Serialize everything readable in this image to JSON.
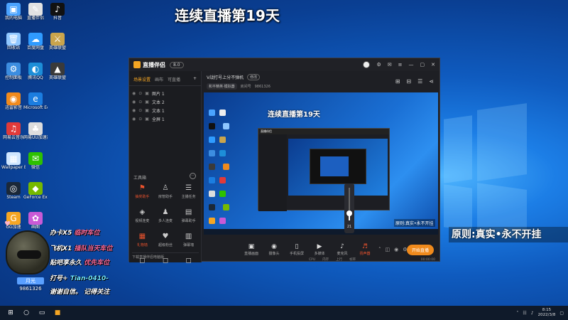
{
  "stream_title": "连续直播第19天",
  "desktop": {
    "icons": [
      {
        "label": "我的电脑",
        "color": "#4aa3ff",
        "glyph": "▣",
        "col": 0,
        "row": 0
      },
      {
        "label": "回收站",
        "color": "#8fc7ff",
        "glyph": "🗑",
        "col": 0,
        "row": 1
      },
      {
        "label": "控制面板",
        "color": "#3c8de0",
        "glyph": "⚙",
        "col": 0,
        "row": 2
      },
      {
        "label": "迅雷影音",
        "color": "#f08a1c",
        "glyph": "◉",
        "col": 0,
        "row": 3
      },
      {
        "label": "网易云音乐",
        "color": "#e03a3a",
        "glyph": "♫",
        "col": 0,
        "row": 4
      },
      {
        "label": "Wallpaper Engine",
        "color": "#cfe6ff",
        "glyph": "▦",
        "col": 0,
        "row": 5
      },
      {
        "label": "Steam",
        "color": "#1b2838",
        "glyph": "◎",
        "col": 0,
        "row": 6
      },
      {
        "label": "GG加速",
        "color": "#f5a623",
        "glyph": "G",
        "col": 0,
        "row": 7
      },
      {
        "label": "直播伴侣",
        "color": "#e2e2e2",
        "glyph": "✎",
        "col": 1,
        "row": 0
      },
      {
        "label": "百度网盘",
        "color": "#2f9bff",
        "glyph": "☁",
        "col": 1,
        "row": 1
      },
      {
        "label": "腾讯QQ",
        "color": "#1d8ed8",
        "glyph": "◐",
        "col": 1,
        "row": 2
      },
      {
        "label": "Microsoft Edge",
        "color": "#1b7de0",
        "glyph": "e",
        "col": 1,
        "row": 3
      },
      {
        "label": "网易UU加速器",
        "color": "#dddddd",
        "glyph": "♣",
        "col": 1,
        "row": 4
      },
      {
        "label": "微信",
        "color": "#2dc100",
        "glyph": "✉",
        "col": 1,
        "row": 5
      },
      {
        "label": "GeForce Experience",
        "color": "#76b900",
        "glyph": "◆",
        "col": 1,
        "row": 6
      },
      {
        "label": "画图",
        "color": "#c95ad6",
        "glyph": "✿",
        "col": 1,
        "row": 7
      },
      {
        "label": "抖音",
        "color": "#111111",
        "glyph": "♪",
        "col": 2,
        "row": 0
      },
      {
        "label": "英雄联盟",
        "color": "#c9a44c",
        "glyph": "⚔",
        "col": 2,
        "row": 1
      },
      {
        "label": "英雄联盟",
        "color": "#3a3a3a",
        "glyph": "▲",
        "col": 2,
        "row": 2
      }
    ]
  },
  "app": {
    "logo": "直播伴侣",
    "version_badge": "8.0",
    "title_icons": [
      "settings-icon",
      "message-icon",
      "menu-icon",
      "minimize-icon",
      "maximize-icon",
      "close-icon"
    ],
    "scene_tabs": [
      "场景设置",
      "画布",
      "可直播"
    ],
    "scene_plus": "+",
    "sources": [
      {
        "name": "图片 1"
      },
      {
        "name": "文本 2"
      },
      {
        "name": "文本 1"
      },
      {
        "name": "全屏 1"
      }
    ],
    "tools_title": "工具箱",
    "tools": [
      {
        "label": "抽奖助手",
        "glyph": "⚑",
        "hot": true
      },
      {
        "label": "房管助手",
        "glyph": "♙",
        "hot": false
      },
      {
        "label": "主播任务",
        "glyph": "☰",
        "hot": false
      },
      {
        "label": "视频连麦",
        "glyph": "◈",
        "hot": false
      },
      {
        "label": "多人连麦",
        "glyph": "♟",
        "hot": false
      },
      {
        "label": "弹幕助手",
        "glyph": "▤",
        "hot": false
      },
      {
        "label": "礼物墙",
        "glyph": "▦",
        "hot": true
      },
      {
        "label": "超级粉丝",
        "glyph": "♥",
        "hot": false
      },
      {
        "label": "弹幕墙",
        "glyph": "▥",
        "hot": false
      },
      {
        "label": "",
        "glyph": "◻",
        "hot": false
      },
      {
        "label": "",
        "glyph": "◻",
        "hot": false
      },
      {
        "label": "",
        "glyph": "◻",
        "hot": false
      }
    ],
    "pc_bar": "下载直播伴侣电脑版",
    "room": {
      "title": "V战打号上分不弹机",
      "edit_label": "修改",
      "category": "和平精英·模拟器",
      "room_id_label": "房间号",
      "room_id": "9861326"
    },
    "head_icons": [
      "gift-icon",
      "share-icon",
      "chat-icon",
      "more-icon"
    ],
    "preview_title": "连续直播第19天",
    "preview_overlay": "原则:真实•永不开挂",
    "bottom": [
      {
        "label": "直播画面",
        "glyph": "▣",
        "red": false
      },
      {
        "label": "摄像头",
        "glyph": "◉",
        "red": false
      },
      {
        "label": "手机投屏",
        "glyph": "▯",
        "red": false
      },
      {
        "label": "多媒体",
        "glyph": "▶",
        "red": false
      },
      {
        "label": "麦克风",
        "glyph": "♪",
        "red": false
      },
      {
        "label": "扬声器",
        "glyph": "♬",
        "red": true
      }
    ],
    "start_button": "开始直播",
    "status": [
      "CPU",
      "内存",
      "上行",
      "帧率"
    ],
    "status_time": "00:00:00",
    "volume_level": "21"
  },
  "overlays": {
    "principle": "原则:真实•永不开挂",
    "lines": [
      {
        "a": "办卡X5",
        "b": "临时车位"
      },
      {
        "a": "飞机X1",
        "b": "插队当天车位"
      },
      {
        "a": "贴吧享永久",
        "b": "优先车位"
      },
      {
        "a": "打号+",
        "b": "Tian-0410-"
      },
      {
        "a": "谢谢自信。",
        "b": "记得关注"
      }
    ],
    "streamer_name": "月光",
    "streamer_id": "9861326"
  },
  "taskbar": {
    "time": "8:15",
    "date": "2022/3/8"
  }
}
